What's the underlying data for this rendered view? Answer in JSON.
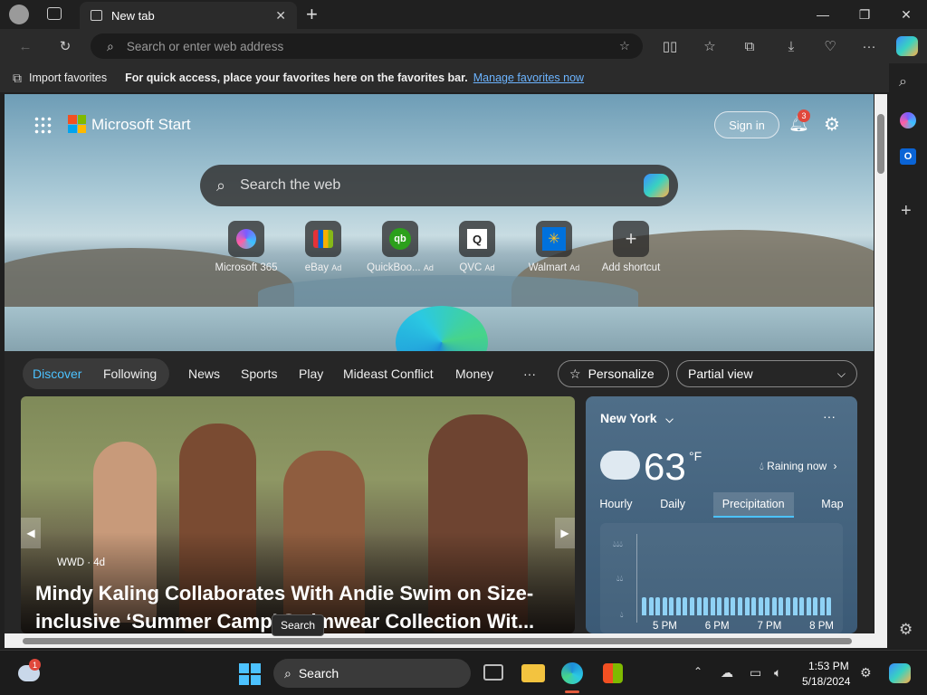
{
  "browser": {
    "tab_title": "New tab",
    "address_placeholder": "Search or enter web address",
    "favbar": {
      "import_label": "Import favorites",
      "hint": "For quick access, place your favorites here on the favorites bar.",
      "manage_link": "Manage favorites now"
    }
  },
  "start": {
    "brand": "Microsoft Start",
    "sign_in": "Sign in",
    "notification_count": "3",
    "search_placeholder": "Search the web",
    "shortcuts": [
      {
        "label": "Microsoft 365",
        "ad": ""
      },
      {
        "label": "eBay",
        "ad": "Ad"
      },
      {
        "label": "QuickBoo...",
        "ad": "Ad"
      },
      {
        "label": "QVC",
        "ad": "Ad"
      },
      {
        "label": "Walmart",
        "ad": "Ad"
      },
      {
        "label": "Add shortcut",
        "ad": ""
      }
    ],
    "feed_nav": {
      "discover": "Discover",
      "following": "Following",
      "links": [
        "News",
        "Sports",
        "Play",
        "Mideast Conflict",
        "Money"
      ],
      "more": "···",
      "personalize": "Personalize",
      "view_select": "Partial view"
    },
    "hero_article": {
      "source": "WWD · 4d",
      "headline": "Mindy Kaling Collaborates With Andie Swim on Size-inclusive ‘Summer Camp’ Swimwear Collection Wit..."
    },
    "weather": {
      "location": "New York",
      "temperature": "63",
      "unit": "°F",
      "status": "Raining now",
      "tabs": [
        "Hourly",
        "Daily",
        "Precipitation",
        "Map"
      ],
      "active_tab": "Precipitation",
      "times": [
        "5 PM",
        "6 PM",
        "7 PM",
        "8 PM"
      ],
      "bars": [
        0.55,
        0.55,
        0.55,
        0.55,
        0.55,
        0.55,
        0.55,
        0.55,
        0.55,
        0.55,
        0.55,
        0.55,
        0.55,
        0.55,
        0.55,
        0.55,
        0.55,
        0.55,
        0.55,
        0.55,
        0.55,
        0.55,
        0.55,
        0.55,
        0.55,
        0.55,
        0.55,
        0.55
      ]
    },
    "tooltip": "Search"
  },
  "taskbar": {
    "search_label": "Search",
    "widgets_badge": "1",
    "time": "1:53 PM",
    "date": "5/18/2024"
  },
  "colors": {
    "accent": "#4cc2ff",
    "link": "#6cb4ff",
    "notification": "#e0483c"
  }
}
